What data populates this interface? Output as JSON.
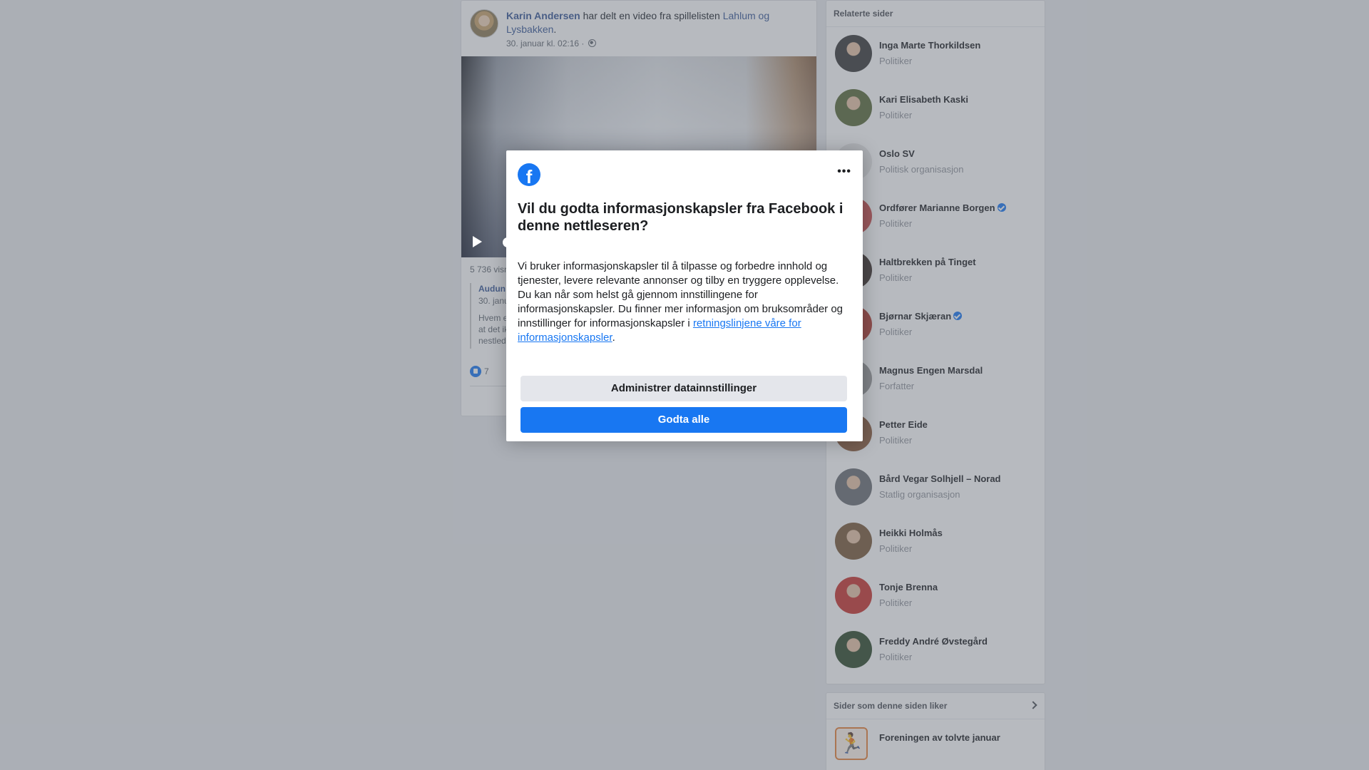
{
  "post": {
    "author": "Karin Andersen",
    "action_text": " har delt en video fra spillelisten ",
    "playlist_link": "Lahlum og Lysbakken",
    "period": ".",
    "timestamp": "30. januar kl. 02:16 · ",
    "views_text": "5 736 visn",
    "quote_author": "Audun",
    "quote_date": "30. janu",
    "quote_text": "Hvem e\nat det ik\nnestlede",
    "reaction_count": "7"
  },
  "sidebar": {
    "related_title": "Relaterte sider",
    "related_pages": [
      {
        "name": "Inga Marte Thorkildsen",
        "category": "Politiker",
        "verified": false,
        "color": "#3a3a3a"
      },
      {
        "name": "Kari Elisabeth Kaski",
        "category": "Politiker",
        "verified": false,
        "color": "#5a6b3a"
      },
      {
        "name": "Oslo SV",
        "category": "Politisk organisasjon",
        "verified": false,
        "color": "#e8e8e8"
      },
      {
        "name": "Ordfører Marianne Borgen",
        "category": "Politiker",
        "verified": true,
        "color": "#c84b4b"
      },
      {
        "name": "Haltbrekken på Tinget",
        "category": "Politiker",
        "verified": false,
        "color": "#3b2e28"
      },
      {
        "name": "Bjørnar Skjæran",
        "category": "Politiker",
        "verified": true,
        "color": "#b13a2e"
      },
      {
        "name": "Magnus Engen Marsdal",
        "category": "Forfatter",
        "verified": false,
        "color": "#9a9a9a"
      },
      {
        "name": "Petter Eide",
        "category": "Politiker",
        "verified": false,
        "color": "#8a5a3a"
      },
      {
        "name": "Bård Vegar Solhjell – Norad",
        "category": "Statlig organisasjon",
        "verified": false,
        "color": "#6b6e73"
      },
      {
        "name": "Heikki Holmås",
        "category": "Politiker",
        "verified": false,
        "color": "#7a5a3a"
      },
      {
        "name": "Tonje Brenna",
        "category": "Politiker",
        "verified": false,
        "color": "#c8342e"
      },
      {
        "name": "Freddy André Øvstegård",
        "category": "Politiker",
        "verified": false,
        "color": "#2f4a2a"
      }
    ],
    "likes_title": "Sider som denne siden liker",
    "liked_page": "Foreningen av tolvte januar"
  },
  "dialog": {
    "more_label": "•••",
    "logo_letter": "f",
    "title": "Vil du godta informasjonskapsler fra Facebook i denne nettleseren?",
    "body": "Vi bruker informasjonskapsler til å tilpasse og forbedre innhold og tjenester, levere relevante annonser og tilby en tryggere opplevelse. Du kan når som helst gå gjennom innstillingene for informasjonskapsler. Du finner mer informasjon om bruksområder og innstillinger for informasjonskapsler i ",
    "policy_link": "retningslinjene våre for informasjonskapsler",
    "body_end": ".",
    "manage_button": "Administrer datainnstillinger",
    "accept_button": "Godta alle"
  },
  "colors": {
    "brand": "#1877f2",
    "link": "#385898",
    "overlay": "#606770"
  }
}
